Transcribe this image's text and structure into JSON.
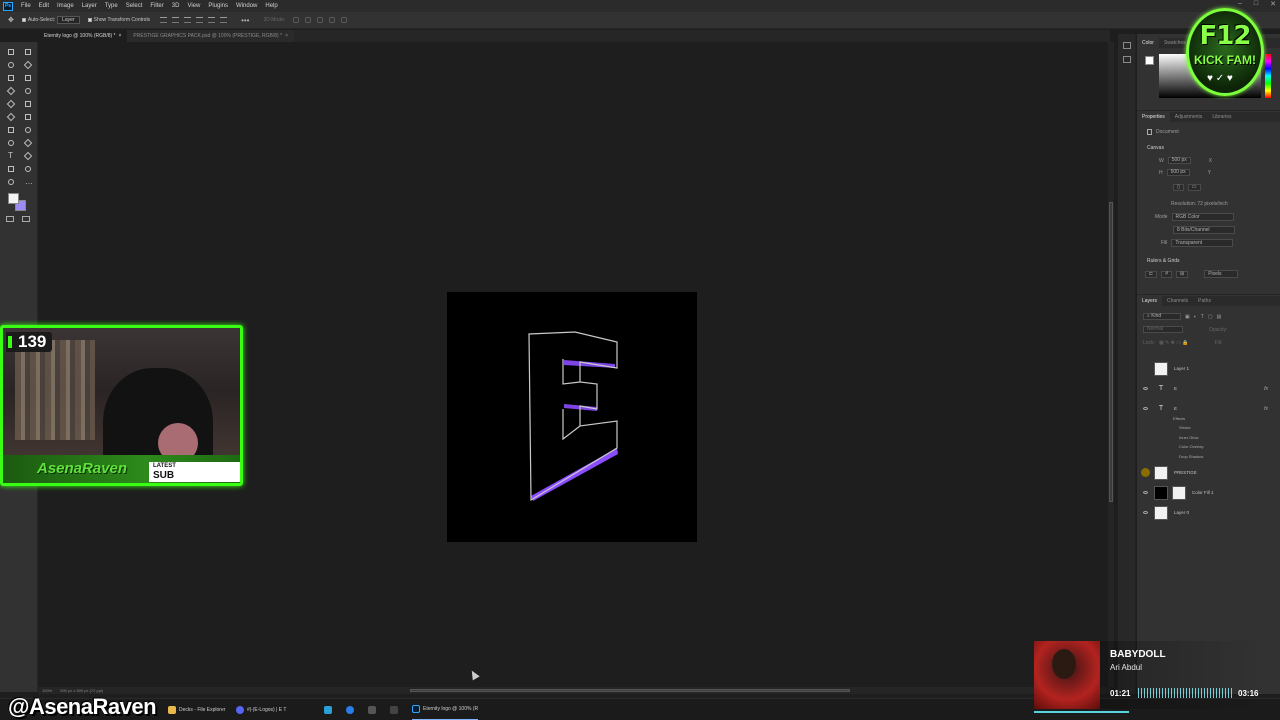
{
  "menu": {
    "app_badge": "Ps",
    "items": [
      "File",
      "Edit",
      "Image",
      "Layer",
      "Type",
      "Select",
      "Filter",
      "3D",
      "View",
      "Plugins",
      "Window",
      "Help"
    ]
  },
  "options": {
    "auto_select_label": "Auto-Select:",
    "auto_select_value": "Layer",
    "show_transform_label": "Show Transform Controls",
    "mode_3d": "3D Mode:"
  },
  "tabs": [
    {
      "label": "Eternity logo @ 100% (RGB/8) *"
    },
    {
      "label": "PRESTIGE GRAPHICS PACK.psd @ 100% (PRESTIGE, RGB/8) *"
    }
  ],
  "status": {
    "zoom": "100%",
    "doc_size": "500 px x 500 px (72 ppi)"
  },
  "canvas": {
    "background": "#000000",
    "glyph": "E",
    "outline_color": "#c9c9c9",
    "glow_color": "#8b4dff"
  },
  "colors": {
    "accent_green": "#39ff14",
    "foreground_swatch": "#f4f4f4",
    "background_swatch": "#9a8cf0"
  },
  "right_panel": {
    "color_tabs": [
      "Color",
      "Swatches"
    ],
    "prop_tabs": [
      "Properties",
      "Adjustments",
      "Libraries"
    ],
    "document_label": "Document",
    "canvas_section": "Canvas",
    "width_label": "W",
    "width_value": "500 px",
    "height_label": "H",
    "height_value": "500 px",
    "x_label": "X",
    "y_label": "Y",
    "resolution": "Resolution: 72 pixels/inch",
    "mode_label": "Mode",
    "mode_value": "RGB Color",
    "bit_depth": "8 Bits/Channel",
    "fill_label": "Fill",
    "fill_value": "Transparent",
    "rulers_section": "Rulers & Grids",
    "units_value": "Pixels",
    "layer_tabs": [
      "Layers",
      "Channels",
      "Paths"
    ],
    "kind_label": "Kind",
    "blend_mode": "Normal",
    "opacity_label": "Opacity:",
    "lock_label": "Lock:",
    "fill_lbl": "Fill:"
  },
  "layers": [
    {
      "name": "Layer 1",
      "kind": "pixel"
    },
    {
      "name": "E",
      "kind": "text",
      "fx": "fx"
    },
    {
      "name": "E",
      "kind": "text",
      "fx": "fx"
    },
    {
      "name": "PRESTIGE",
      "kind": "pixel"
    },
    {
      "name": "Color Fill 1",
      "kind": "fill"
    },
    {
      "name": "Layer 0",
      "kind": "pixel"
    }
  ],
  "effects": [
    "Effects",
    "Stroke",
    "Inner Glow",
    "Color Overlay",
    "Drop Shadow"
  ],
  "badge": {
    "title": "F12",
    "subtitle": "KICK FAM!"
  },
  "webcam": {
    "count": "139",
    "name": "AsenaRaven",
    "latest_label": "LATEST",
    "latest_value": "SUB"
  },
  "handle": "@AsenaRaven",
  "taskbar": [
    {
      "label": "Decks - File Explorer"
    },
    {
      "label": "#|-(E-Logos) | E T"
    },
    {
      "label": "Eternity logo @ 100% (R"
    }
  ],
  "now_playing": {
    "title": "BABYDOLL",
    "artist": "Ari Abdul",
    "elapsed": "01:21",
    "total": "03:16",
    "progress": 0.41
  }
}
